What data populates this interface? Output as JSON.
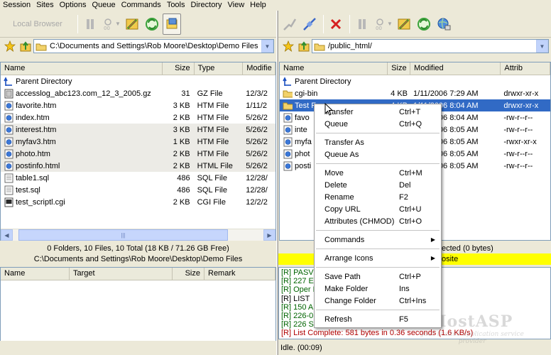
{
  "menu": [
    "Session",
    "Sites",
    "Options",
    "Queue",
    "Commands",
    "Tools",
    "Directory",
    "View",
    "Help"
  ],
  "left": {
    "toolbar": {
      "local_browser_label": "Local Browser"
    },
    "path": "C:\\Documents and Settings\\Rob Moore\\Desktop\\Demo Files",
    "columns": [
      "Name",
      "Size",
      "Type",
      "Modifie"
    ],
    "files": [
      {
        "name": "Parent Directory",
        "size": "",
        "type": "",
        "modified": "",
        "icon": "parent-directory-icon"
      },
      {
        "name": "accesslog_abc123.com_12_3_2005.gz",
        "size": "31",
        "type": "GZ File",
        "modified": "12/3/2",
        "icon": "archive-file-icon"
      },
      {
        "name": "favorite.htm",
        "size": "3 KB",
        "type": "HTM File",
        "modified": "1/11/2",
        "icon": "html-file-icon"
      },
      {
        "name": "index.htm",
        "size": "2 KB",
        "type": "HTM File",
        "modified": "5/26/2",
        "icon": "html-file-icon"
      },
      {
        "name": "interest.htm",
        "size": "3 KB",
        "type": "HTM File",
        "modified": "5/26/2",
        "icon": "html-file-icon"
      },
      {
        "name": "myfav3.htm",
        "size": "1 KB",
        "type": "HTM File",
        "modified": "5/26/2",
        "icon": "html-file-icon"
      },
      {
        "name": "photo.htm",
        "size": "2 KB",
        "type": "HTM File",
        "modified": "5/26/2",
        "icon": "html-file-icon"
      },
      {
        "name": "postinfo.html",
        "size": "2 KB",
        "type": "HTML File",
        "modified": "5/26/2",
        "icon": "html-file-icon"
      },
      {
        "name": "table1.sql",
        "size": "486",
        "type": "SQL File",
        "modified": "12/28/",
        "icon": "text-file-icon"
      },
      {
        "name": "test.sql",
        "size": "486",
        "type": "SQL File",
        "modified": "12/28/",
        "icon": "text-file-icon"
      },
      {
        "name": "test_scriptl.cgi",
        "size": "2 KB",
        "type": "CGI File",
        "modified": "12/2/2",
        "icon": "script-file-icon"
      }
    ],
    "status": "0 Folders, 10 Files, 10 Total (18 KB / 71.26 GB Free)",
    "path_status": "C:\\Documents and Settings\\Rob Moore\\Desktop\\Demo Files"
  },
  "right": {
    "path": "/public_html/",
    "columns": [
      "Name",
      "Size",
      "Modified",
      "Attrib"
    ],
    "files": [
      {
        "name": "Parent Directory",
        "size": "",
        "modified": "",
        "attrib": "",
        "icon": "parent-directory-icon"
      },
      {
        "name": "cgi-bin",
        "size": "4 KB",
        "modified": "1/11/2006 7:29 AM",
        "attrib": "drwxr-xr-x",
        "icon": "folder-icon"
      },
      {
        "name": "Test F",
        "size": "4 KB",
        "modified": "1/11/2006 8:04 AM",
        "attrib": "drwxr-xr-x",
        "icon": "folder-icon"
      },
      {
        "name": "favo",
        "size": "",
        "modified": "1/11/2006 8:04 AM",
        "attrib": "-rw-r--r--",
        "icon": "html-file-icon"
      },
      {
        "name": "inte",
        "size": "",
        "modified": "1/11/2006 8:05 AM",
        "attrib": "-rw-r--r--",
        "icon": "html-file-icon"
      },
      {
        "name": "myfa",
        "size": "",
        "modified": "1/11/2006 8:05 AM",
        "attrib": "-rwxr-xr-x",
        "icon": "html-file-icon"
      },
      {
        "name": "phot",
        "size": "",
        "modified": "1/11/2006 8:05 AM",
        "attrib": "-rw-r--r--",
        "icon": "html-file-icon"
      },
      {
        "name": "posti",
        "size": "",
        "modified": "1/11/2006 8:05 AM",
        "attrib": "-rw-r--r--",
        "icon": "html-file-icon"
      }
    ],
    "status": "ected (0 bytes)",
    "site_status": "osite"
  },
  "queue": {
    "columns": [
      "Name",
      "Target",
      "Size",
      "Remark"
    ]
  },
  "log": [
    {
      "text": "[R] PASV",
      "color": "#006400"
    },
    {
      "text": "[R] 227 E                                        211,241)",
      "color": "#006400"
    },
    {
      "text": "[R] Oper                                        PORT: 54257",
      "color": "#006400"
    },
    {
      "text": "[R] LIST",
      "color": "#000000"
    },
    {
      "text": "[R] 150 A",
      "color": "#006400"
    },
    {
      "text": "[R] 226-0",
      "color": "#006400"
    },
    {
      "text": "[R] 226 S",
      "color": "#006400"
    },
    {
      "text": "[R] List Complete: 581 bytes in 0.36 seconds (1.6 KB/s)",
      "color": "#b00000"
    }
  ],
  "bottom": {
    "idle": "Idle. (00:09)"
  },
  "watermark": {
    "title": "HostASP",
    "tagline": "your trusted application service provider"
  },
  "context_menu": {
    "items": [
      {
        "type": "item",
        "label": "Transfer",
        "shortcut": "Ctrl+T"
      },
      {
        "type": "item",
        "label": "Queue",
        "shortcut": "Ctrl+Q"
      },
      {
        "type": "sep"
      },
      {
        "type": "item",
        "label": "Transfer As",
        "shortcut": ""
      },
      {
        "type": "item",
        "label": "Queue As",
        "shortcut": ""
      },
      {
        "type": "sep"
      },
      {
        "type": "item",
        "label": "Move",
        "shortcut": "Ctrl+M"
      },
      {
        "type": "item",
        "label": "Delete",
        "shortcut": "Del"
      },
      {
        "type": "item",
        "label": "Rename",
        "shortcut": "F2"
      },
      {
        "type": "item",
        "label": "Copy URL",
        "shortcut": "Ctrl+U"
      },
      {
        "type": "item",
        "label": "Attributes (CHMOD)",
        "shortcut": "Ctrl+O"
      },
      {
        "type": "sep"
      },
      {
        "type": "submenu",
        "label": "Commands",
        "shortcut": ""
      },
      {
        "type": "sep"
      },
      {
        "type": "submenu",
        "label": "Arrange Icons",
        "shortcut": ""
      },
      {
        "type": "sep"
      },
      {
        "type": "item",
        "label": "Save Path",
        "shortcut": "Ctrl+P"
      },
      {
        "type": "item",
        "label": "Make Folder",
        "shortcut": "Ins"
      },
      {
        "type": "item",
        "label": "Change Folder",
        "shortcut": "Ctrl+Ins"
      },
      {
        "type": "sep"
      },
      {
        "type": "item",
        "label": "Refresh",
        "shortcut": "F5"
      }
    ]
  },
  "colors": {
    "selection": "#316ac5",
    "status_yellow": "#ffff00",
    "window_bg": "#ece9d8"
  }
}
